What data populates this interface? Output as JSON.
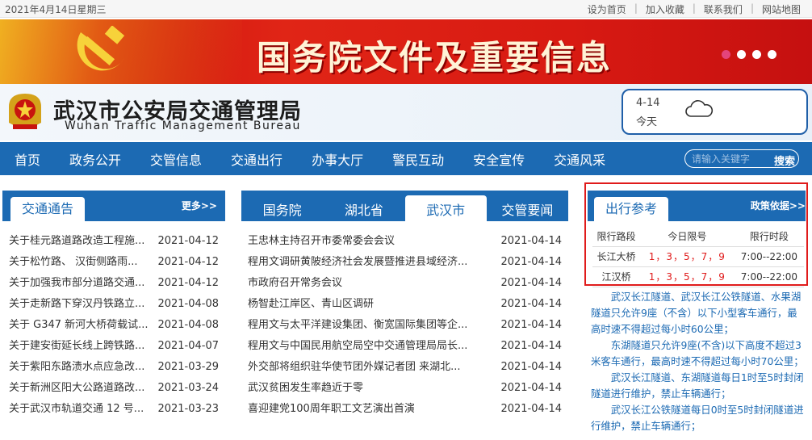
{
  "topbar": {
    "date": "2021年4月14日星期三",
    "links": [
      "设为首页",
      "加入收藏",
      "联系我们",
      "网站地图"
    ]
  },
  "banner": {
    "title": "国务院文件及重要信息"
  },
  "site": {
    "name_cn": "武汉市公安局交通管理局",
    "name_en": "Wuhan Traffic Management Bureau"
  },
  "weather": {
    "date": "4-14",
    "day": "今天",
    "icon": "cloud-icon"
  },
  "nav": {
    "items": [
      "首页",
      "政务公开",
      "交管信息",
      "交通出行",
      "办事大厅",
      "警民互动",
      "安全宣传",
      "交通风采"
    ],
    "search_placeholder": "请输入关键字",
    "search_button": "搜索"
  },
  "panel1": {
    "title": "交通通告",
    "more": "更多>>",
    "items": [
      {
        "title": "关于桂元路道路改造工程施...",
        "date": "2021-04-12"
      },
      {
        "title": "关于松竹路、 汉街侧路雨...",
        "date": "2021-04-12"
      },
      {
        "title": "关于加强我市部分道路交通...",
        "date": "2021-04-12"
      },
      {
        "title": "关于走新路下穿汉丹铁路立...",
        "date": "2021-04-08"
      },
      {
        "title": "关于 G347 新河大桥荷载试...",
        "date": "2021-04-08"
      },
      {
        "title": "关于建安街延长线上跨铁路...",
        "date": "2021-04-07"
      },
      {
        "title": "关于紫阳东路渍水点应急改...",
        "date": "2021-03-29"
      },
      {
        "title": "关于新洲区阳大公路道路改...",
        "date": "2021-03-24"
      },
      {
        "title": "关于武汉市轨道交通 12 号...",
        "date": "2021-03-23"
      }
    ]
  },
  "panel2": {
    "tabs": [
      "国务院",
      "湖北省",
      "武汉市",
      "交管要闻"
    ],
    "active_tab": 2,
    "items": [
      {
        "title": "王忠林主持召开市委常委会会议",
        "date": "2021-04-14"
      },
      {
        "title": "程用文调研黄陂经济社会发展暨推进县域经济...",
        "date": "2021-04-14"
      },
      {
        "title": "市政府召开常务会议",
        "date": "2021-04-14"
      },
      {
        "title": "杨智赴江岸区、青山区调研",
        "date": "2021-04-14"
      },
      {
        "title": "程用文与太平洋建设集团、衡宽国际集团等企...",
        "date": "2021-04-14"
      },
      {
        "title": "程用文与中国民用航空局空中交通管理局局长...",
        "date": "2021-04-14"
      },
      {
        "title": "外交部将组织驻华使节团外媒记者团 来湖北...",
        "date": "2021-04-14"
      },
      {
        "title": "武汉贫困发生率趋近于零",
        "date": "2021-04-14"
      },
      {
        "title": "喜迎建党100周年职工文艺演出首演",
        "date": "2021-04-14"
      }
    ]
  },
  "panel3": {
    "title": "出行参考",
    "more": "政策依据>>",
    "headers": [
      "限行路段",
      "今日限号",
      "限行时段"
    ],
    "rows": [
      {
        "road": "长江大桥",
        "nums": "1，3，5，7，9",
        "time": "7:00--22:00"
      },
      {
        "road": "江汉桥",
        "nums": "1，3，5，7，9",
        "time": "7:00--22:00"
      }
    ],
    "notices": [
      "武汉长江隧道、武汉长江公铁隧道、水果湖隧道只允许9座（不含）以下小型客车通行，最高时速不得超过每小时60公里；",
      "东湖隧道只允许9座(不含)以下高度不超过3米客车通行，最高时速不得超过每小时70公里；",
      "武汉长江隧道、东湖隧道每日1时至5时封闭隧道进行维护，禁止车辆通行；",
      "武汉长江公铁隧道每日0时至5时封闭隧道进行维护，禁止车辆通行；"
    ]
  },
  "colors": {
    "primary": "#1c6ab3",
    "banner_red": "#d81a12",
    "highlight": "#e01b1b"
  }
}
